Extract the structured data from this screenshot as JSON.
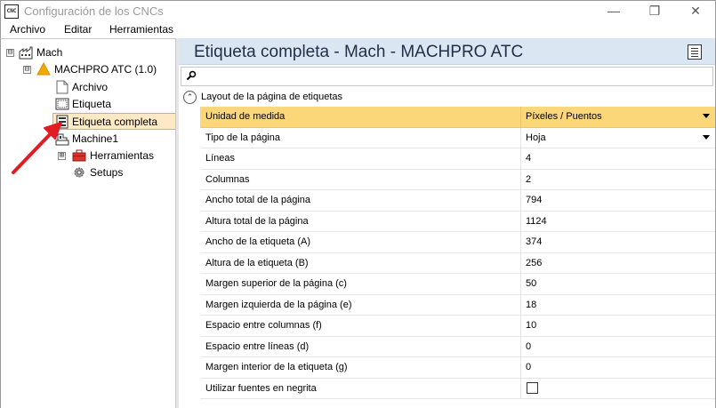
{
  "window": {
    "title": "Configuración de los CNCs",
    "app_icon_text": "CNC",
    "minimize_glyph": "—",
    "maximize_glyph": "❐",
    "close_glyph": "✕"
  },
  "menu": {
    "items": [
      {
        "label": "Archivo"
      },
      {
        "label": "Editar"
      },
      {
        "label": "Herramientas"
      }
    ]
  },
  "tree": {
    "nodes": [
      {
        "label": "Mach",
        "icon": "factory-icon",
        "expander": "⊟"
      },
      {
        "label": "MACHPRO ATC (1.0)",
        "icon": "warning-icon",
        "expander": "⊟"
      },
      {
        "label": "Archivo",
        "icon": "document-icon"
      },
      {
        "label": "Etiqueta",
        "icon": "label-icon"
      },
      {
        "label": "Etiqueta completa",
        "icon": "label-sheet-icon",
        "selected": true
      },
      {
        "label": "Machine1",
        "icon": "machine-icon"
      },
      {
        "label": "Herramientas",
        "icon": "toolbox-icon",
        "expander": "⊞"
      },
      {
        "label": "Setups",
        "icon": "gear-icon"
      }
    ]
  },
  "main": {
    "title": "Etiqueta completa - Mach - MACHPRO ATC",
    "search_placeholder": "",
    "group": {
      "label": "Layout de la página de etiquetas",
      "collapse_glyph": "⌃"
    },
    "properties": [
      {
        "name": "Unidad de medida",
        "value": "Píxeles / Puentos",
        "dropdown": true
      },
      {
        "name": "Tipo de la página",
        "value": "Hoja",
        "dropdown": true
      },
      {
        "name": "Líneas",
        "value": "4"
      },
      {
        "name": "Columnas",
        "value": "2"
      },
      {
        "name": "Ancho total de la página",
        "value": "794"
      },
      {
        "name": "Altura total de la página",
        "value": "1124"
      },
      {
        "name": "Ancho de la etiqueta (A)",
        "value": "374"
      },
      {
        "name": "Altura de la etiqueta (B)",
        "value": "256"
      },
      {
        "name": "Margen superior de la página (c)",
        "value": "50"
      },
      {
        "name": "Margen izquierda de la página (e)",
        "value": "18"
      },
      {
        "name": "Espacio entre columnas (f)",
        "value": "10"
      },
      {
        "name": "Espacio entre líneas (d)",
        "value": "0"
      },
      {
        "name": "Margen interior de la etiqueta (g)",
        "value": "0"
      },
      {
        "name": "Utilizar fuentes en negrita",
        "value": "",
        "checkbox": true,
        "checked": false
      }
    ]
  },
  "colors": {
    "selected_row": "#fbd77a",
    "selected_tree_bg": "#fde9c5",
    "selected_tree_border": "#f3a93a",
    "header_bg": "#dbe6f3",
    "annotation_arrow": "#e31b23"
  }
}
